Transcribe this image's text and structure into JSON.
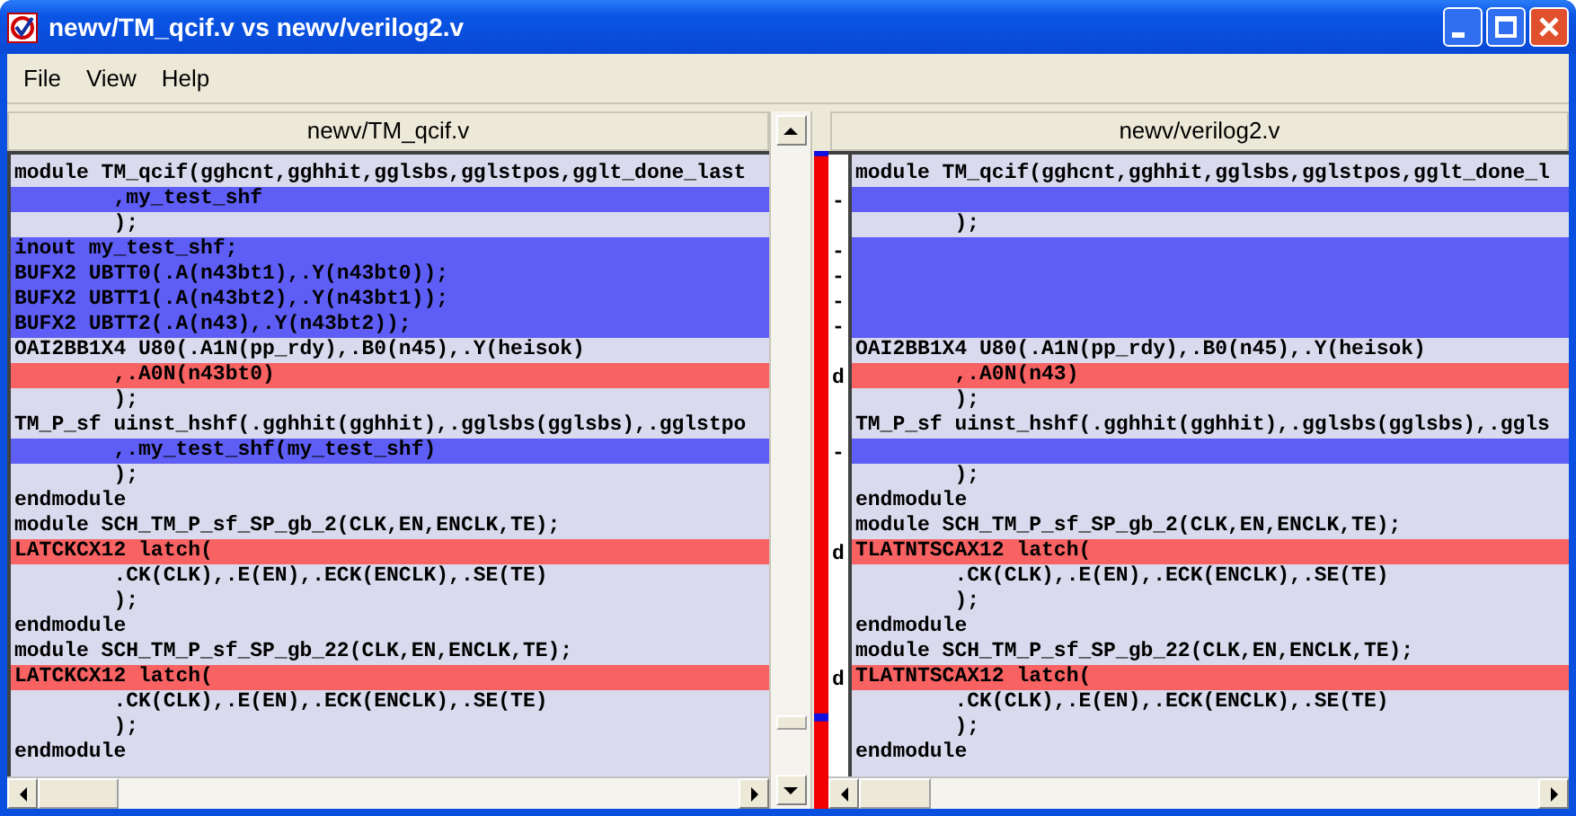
{
  "window": {
    "title": "newv/TM_qcif.v vs newv/verilog2.v"
  },
  "menu": [
    "File",
    "View",
    "Help"
  ],
  "panes": [
    {
      "title": "newv/TM_qcif.v"
    },
    {
      "title": "newv/verilog2.v"
    }
  ],
  "rows": [
    {
      "kind": "same",
      "left": "module TM_qcif(gghcnt,gghhit,gglsbs,gglstpos,gglt_done_last",
      "right": "module TM_qcif(gghcnt,gghhit,gglsbs,gglstpos,gglt_done_l"
    },
    {
      "kind": "added",
      "left": "        ,my_test_shf",
      "marker": "-"
    },
    {
      "kind": "same",
      "left": "        );",
      "right": "        );"
    },
    {
      "kind": "added",
      "left": "inout my_test_shf;",
      "marker": "-"
    },
    {
      "kind": "added",
      "left": "BUFX2 UBTT0(.A(n43bt1),.Y(n43bt0));",
      "marker": "-"
    },
    {
      "kind": "added",
      "left": "BUFX2 UBTT1(.A(n43bt2),.Y(n43bt1));",
      "marker": "-"
    },
    {
      "kind": "added",
      "left": "BUFX2 UBTT2(.A(n43),.Y(n43bt2));",
      "marker": "-"
    },
    {
      "kind": "same",
      "left": "OAI2BB1X4 U80(.A1N(pp_rdy),.B0(n45),.Y(heisok)",
      "right": "OAI2BB1X4 U80(.A1N(pp_rdy),.B0(n45),.Y(heisok)"
    },
    {
      "kind": "changed",
      "left": "        ,.A0N(n43bt0)",
      "right": "        ,.A0N(n43)",
      "marker": "d"
    },
    {
      "kind": "same",
      "left": "        );",
      "right": "        );"
    },
    {
      "kind": "same",
      "left": "TM_P_sf uinst_hshf(.gghhit(gghhit),.gglsbs(gglsbs),.gglstpo",
      "right": "TM_P_sf uinst_hshf(.gghhit(gghhit),.gglsbs(gglsbs),.ggls"
    },
    {
      "kind": "added",
      "left": "        ,.my_test_shf(my_test_shf)",
      "marker": "-"
    },
    {
      "kind": "same",
      "left": "        );",
      "right": "        );"
    },
    {
      "kind": "same",
      "left": "endmodule",
      "right": "endmodule"
    },
    {
      "kind": "same",
      "left": "module SCH_TM_P_sf_SP_gb_2(CLK,EN,ENCLK,TE);",
      "right": "module SCH_TM_P_sf_SP_gb_2(CLK,EN,ENCLK,TE);"
    },
    {
      "kind": "changed",
      "left": "LATCKCX12 latch(",
      "right": "TLATNTSCAX12 latch(",
      "marker": "d"
    },
    {
      "kind": "same",
      "left": "        .CK(CLK),.E(EN),.ECK(ENCLK),.SE(TE)",
      "right": "        .CK(CLK),.E(EN),.ECK(ENCLK),.SE(TE)"
    },
    {
      "kind": "same",
      "left": "        );",
      "right": "        );"
    },
    {
      "kind": "same",
      "left": "endmodule",
      "right": "endmodule"
    },
    {
      "kind": "same",
      "left": "module SCH_TM_P_sf_SP_gb_22(CLK,EN,ENCLK,TE);",
      "right": "module SCH_TM_P_sf_SP_gb_22(CLK,EN,ENCLK,TE);"
    },
    {
      "kind": "changed",
      "left": "LATCKCX12 latch(",
      "right": "TLATNTSCAX12 latch(",
      "marker": "d"
    },
    {
      "kind": "same",
      "left": "        .CK(CLK),.E(EN),.ECK(ENCLK),.SE(TE)",
      "right": "        .CK(CLK),.E(EN),.ECK(ENCLK),.SE(TE)"
    },
    {
      "kind": "same",
      "left": "        );",
      "right": "        );"
    },
    {
      "kind": "same",
      "left": "endmodule",
      "right": "endmodule"
    }
  ]
}
